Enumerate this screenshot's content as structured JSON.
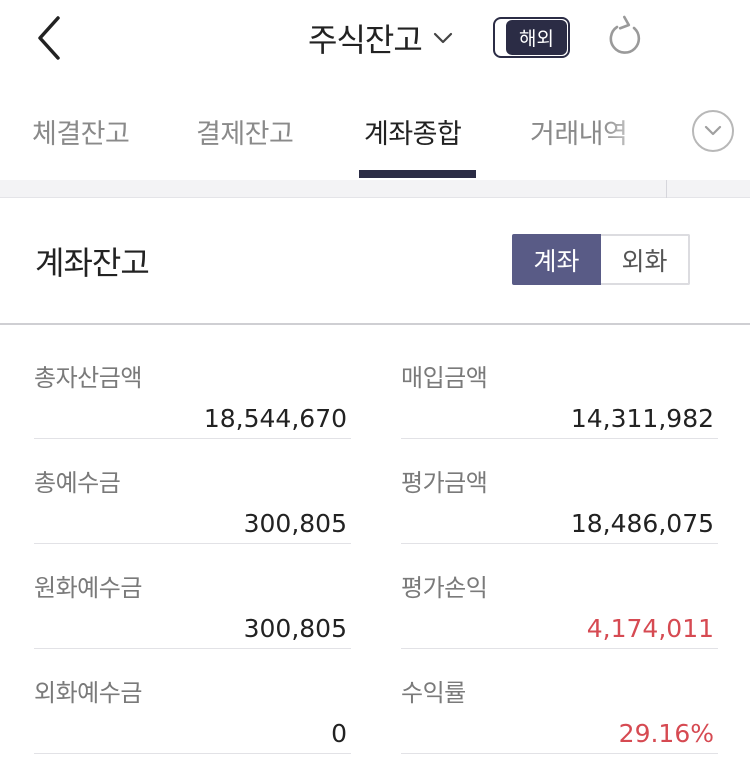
{
  "header": {
    "title": "주식잔고",
    "toggle_label": "해외"
  },
  "tabs": [
    {
      "label": "체결잔고",
      "active": false
    },
    {
      "label": "결제잔고",
      "active": false
    },
    {
      "label": "계좌종합",
      "active": true
    },
    {
      "label": "거래내역",
      "active": false
    }
  ],
  "section": {
    "title": "계좌잔고",
    "segments": [
      "계좌",
      "외화"
    ],
    "selected_segment": "계좌"
  },
  "summary": {
    "left": [
      {
        "label": "총자산금액",
        "value": "18,544,670"
      },
      {
        "label": "총예수금",
        "value": "300,805"
      },
      {
        "label": "원화예수금",
        "value": "300,805"
      },
      {
        "label": "외화예수금",
        "value": "0"
      }
    ],
    "right": [
      {
        "label": "매입금액",
        "value": "14,311,982"
      },
      {
        "label": "평가금액",
        "value": "18,486,075"
      },
      {
        "label": "평가손익",
        "value": "4,174,011"
      },
      {
        "label": "수익률",
        "value": "29.16%"
      }
    ]
  },
  "colors": {
    "primary": "#2b2c45",
    "segment_active": "#595b86",
    "positive": "#d64a52"
  },
  "icons": [
    "back-arrow-icon",
    "chevron-down-icon",
    "refresh-icon",
    "more-chevron-icon"
  ]
}
